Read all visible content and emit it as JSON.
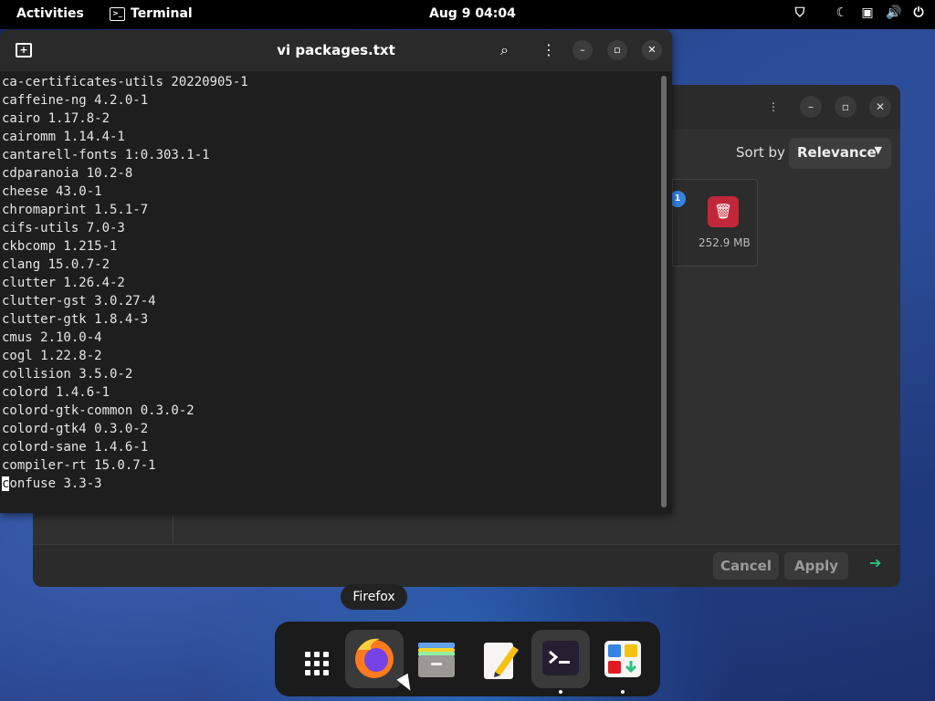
{
  "topbar": {
    "activities": "Activities",
    "app_name": "Terminal",
    "clock": "Aug 9  04:04"
  },
  "terminal": {
    "title": "vi packages.txt",
    "lines": [
      "ca-certificates-utils 20220905-1",
      "caffeine-ng 4.2.0-1",
      "cairo 1.17.8-2",
      "cairomm 1.14.4-1",
      "cantarell-fonts 1:0.303.1-1",
      "cdparanoia 10.2-8",
      "cheese 43.0-1",
      "chromaprint 1.5.1-7",
      "cifs-utils 7.0-3",
      "ckbcomp 1.215-1",
      "clang 15.0.7-2",
      "clutter 1.26.4-2",
      "clutter-gst 3.0.27-4",
      "clutter-gtk 1.8.4-3",
      "cmus 2.10.0-4",
      "cogl 1.22.8-2",
      "collision 3.5.0-2",
      "colord 1.4.6-1",
      "colord-gtk-common 0.3.0-2",
      "colord-gtk4 0.3.0-2",
      "colord-sane 1.4.6-1",
      "compiler-rt 15.0.7-1",
      "confuse 3.3-3"
    ],
    "cursor_line": "confuse 3.3-3",
    "cursor_char": "c",
    "cursor_rest": "onfuse 3.3-3"
  },
  "dialog": {
    "sort_label": "Sort by",
    "sort_value": "Relevance",
    "badge": "1",
    "item_size": "252.9 MB",
    "cancel": "Cancel",
    "apply": "Apply"
  },
  "tooltip": "Firefox",
  "dock": {
    "items": [
      "apps-grid",
      "firefox",
      "files",
      "text-editor",
      "terminal",
      "software"
    ]
  },
  "colors": {
    "accent": "#3584e4",
    "danger": "#c0283a",
    "success": "#2ec27e"
  }
}
